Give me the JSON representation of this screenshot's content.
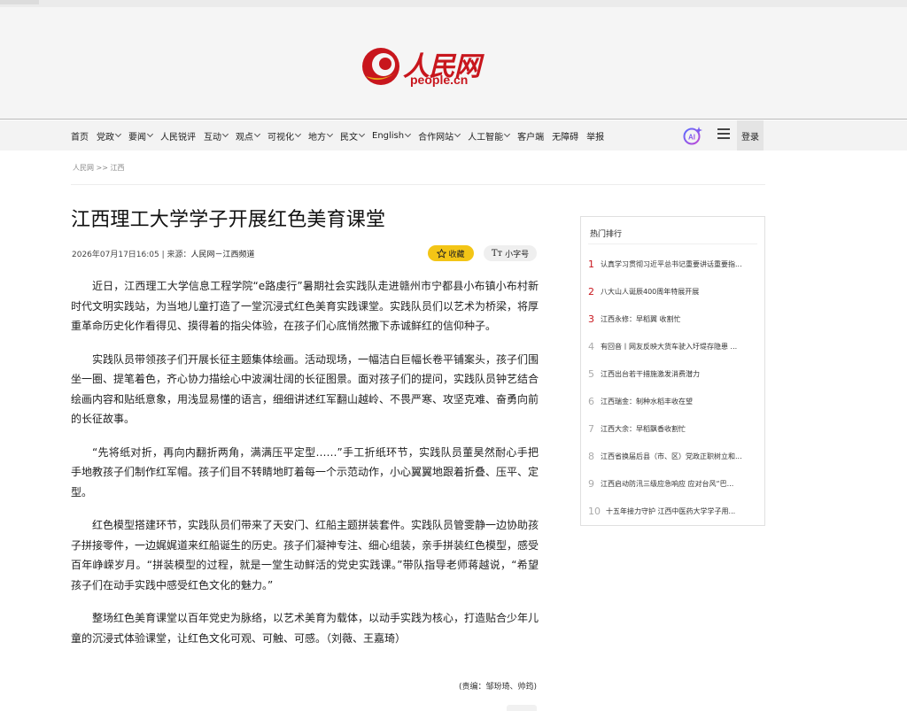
{
  "logo": {
    "zh": "人民网",
    "en": "people.cn"
  },
  "nav": {
    "items": [
      {
        "label": "首页",
        "chevron": false
      },
      {
        "label": "党政",
        "chevron": true
      },
      {
        "label": "要闻",
        "chevron": true
      },
      {
        "label": "人民锐评",
        "chevron": false
      },
      {
        "label": "互动",
        "chevron": true
      },
      {
        "label": "观点",
        "chevron": true
      },
      {
        "label": "可视化",
        "chevron": true
      },
      {
        "label": "地方",
        "chevron": true
      },
      {
        "label": "民文",
        "chevron": true
      },
      {
        "label": "English",
        "chevron": true
      },
      {
        "label": "合作网站",
        "chevron": true
      },
      {
        "label": "人工智能",
        "chevron": true
      },
      {
        "label": "客户端",
        "chevron": false
      },
      {
        "label": "无障碍",
        "chevron": false
      },
      {
        "label": "举报",
        "chevron": false
      }
    ],
    "login_label": "登录"
  },
  "breadcrumb": "人民网 >> 江西",
  "article": {
    "title": "江西理工大学学子开展红色美育课堂",
    "meta": "2026年07月17日16:05 | 来源：",
    "source": "人民网－江西频道",
    "fav_label": "收藏",
    "font_label": "小字号",
    "font_icon": "Tт",
    "paragraphs": [
      "近日，江西理工大学信息工程学院“e路虔行”暑期社会实践队走进赣州市宁都县小布镇小布村新时代文明实践站，为当地儿童打造了一堂沉浸式红色美育实践课堂。实践队员们以艺术为桥梁，将厚重革命历史化作看得见、摸得着的指尖体验，在孩子们心底悄然撒下赤诚鲜红的信仰种子。",
      "实践队员带领孩子们开展长征主题集体绘画。活动现场，一幅洁白巨幅长卷平铺案头，孩子们围坐一圈、提笔着色，齐心协力描绘心中波澜壮阔的长征图景。面对孩子们的提问，实践队员钟艺结合绘画内容和贴纸意象，用浅显易懂的语言，细细讲述红军翻山越岭、不畏严寒、攻坚克难、奋勇向前的长征故事。",
      "“先将纸对折，再向内翻折两角，满满压平定型……”手工折纸环节，实践队员董昊然耐心手把手地教孩子们制作红军帽。孩子们目不转睛地盯着每一个示范动作，小心翼翼地跟着折叠、压平、定型。",
      "红色模型搭建环节，实践队员们带来了天安门、红船主题拼装套件。实践队员管雯静一边协助孩子拼接零件，一边娓娓道来红船诞生的历史。孩子们凝神专注、细心组装，亲手拼装红色模型，感受百年峥嵘岁月。“拼装模型的过程，就是一堂生动鲜活的党史实践课。”带队指导老师蒋越说，“希望孩子们在动手实践中感受红色文化的魅力。”",
      "整场红色美育课堂以百年党史为脉络，以艺术美育为载体，以动手实践为核心，打造贴合少年儿童的沉浸式体验课堂，让红色文化可观、可触、可感。（刘薇、王嘉琦）"
    ],
    "editor": "(责编：邹玢琦、帅筠)"
  },
  "hot": {
    "heading": "热门排行",
    "items": [
      {
        "rank": "1",
        "text": "认真学习贯彻习近平总书记重要讲话重要指..."
      },
      {
        "rank": "2",
        "text": "八大山人诞辰400周年特展开展"
      },
      {
        "rank": "3",
        "text": "江西永修：早稻翼 收割忙"
      },
      {
        "rank": "4",
        "text": "有回音丨网友反映大货车驶入圩堤存隐患 ..."
      },
      {
        "rank": "5",
        "text": "江西出台若干措施激发消费潜力"
      },
      {
        "rank": "6",
        "text": "江西瑞金：制种水稻丰收在望"
      },
      {
        "rank": "7",
        "text": "江西大余：早稻飘香收割忙"
      },
      {
        "rank": "8",
        "text": "江西省换届后县（市、区）党政正职树立和..."
      },
      {
        "rank": "9",
        "text": "江西启动防汛三级应急响应 应对台风“巴..."
      },
      {
        "rank": "10",
        "text": "十五年接力守护 江西中医药大学学子用..."
      }
    ]
  },
  "colors": {
    "brand_red": "#c8161d",
    "fav_yellow": "#f3c516"
  },
  "icons": {
    "ai": "ai-sparkle-icon",
    "menu": "hamburger-menu-icon",
    "star": "star-icon"
  }
}
